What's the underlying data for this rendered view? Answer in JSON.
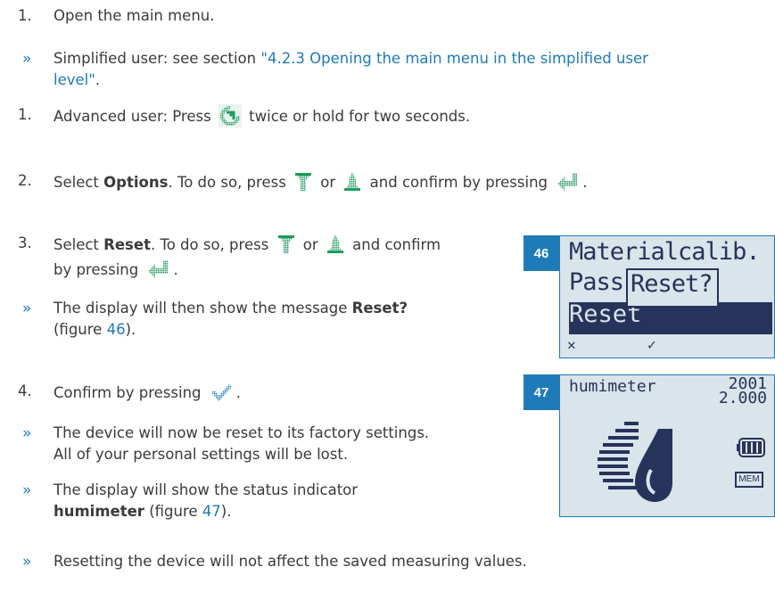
{
  "steps": {
    "s1": {
      "num": "1.",
      "text": "Open the main menu."
    },
    "n1": {
      "text_before": "Simplified user: see section ",
      "link": "\"4.2.3 Opening the main menu in the simplified user",
      "link_cont": "level\"",
      "text_after": "."
    },
    "s2": {
      "num": "1.",
      "text_before": "Advanced user: Press ",
      "text_after": " twice or hold for two seconds."
    },
    "s3": {
      "num": "2.",
      "t1": "Select ",
      "bold": "Options",
      "t2": ". To do so, press ",
      "or": " or ",
      "t3": " and confirm by pressing ",
      "end": "."
    },
    "s4": {
      "num": "3.",
      "t1": "Select ",
      "bold": "Reset",
      "t2": ". To do so, press ",
      "or": " or ",
      "t3": " and confirm",
      "line2": "by pressing ",
      "end": "."
    },
    "n2": {
      "t1": "The display will then show the message ",
      "bold": "Reset?",
      "t2": "(figure ",
      "fig": "46",
      "t3": ")."
    },
    "s5": {
      "num": "4.",
      "text": "Confirm by pressing ",
      "end": "."
    },
    "n3": {
      "line1": "The device will now be reset to its factory settings.",
      "line2": "All of your personal settings will be lost."
    },
    "n4": {
      "line1": "The display will show the status indicator",
      "bold": "humimeter",
      "t2": " (figure ",
      "fig": "47",
      "t3": ")."
    },
    "n5": {
      "text": "Resetting the device will not affect the saved measuring values."
    },
    "bullet": "»"
  },
  "figures": {
    "f46": {
      "number": "46",
      "line1": "Materialcalib.",
      "line2_left": "Pass",
      "popup": "Reset?",
      "line3": "Reset",
      "soft_left": "✕",
      "soft_right": "✓"
    },
    "f47": {
      "number": "47",
      "title": "humimeter",
      "value1": "2001",
      "value2": "2.000",
      "mem": "MEM"
    }
  },
  "icons": {
    "menu": "menu-icon",
    "down": "arrow-down-icon",
    "up": "arrow-up-icon",
    "enter": "enter-icon",
    "check": "checkmark-icon"
  },
  "colors": {
    "accent": "#1f7ab8",
    "text": "#3a3a3a",
    "lcd_bg": "#d9e4eb",
    "lcd_fg": "#26335a"
  }
}
